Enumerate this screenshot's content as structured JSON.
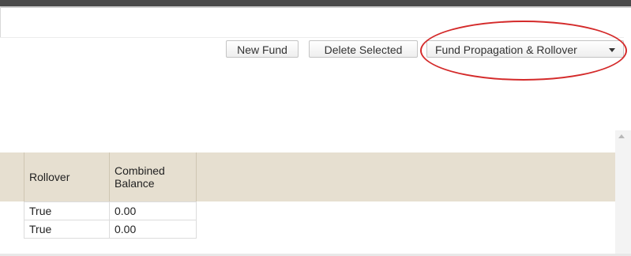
{
  "toolbar": {
    "new_fund_label": "New Fund",
    "delete_selected_label": "Delete Selected",
    "fund_propagation_label": "Fund Propagation & Rollover"
  },
  "icons": {
    "dropdown": "chevron-down-icon",
    "scroll_up": "arrow-up-icon"
  },
  "colors": {
    "highlight_ellipse": "#d42a2a",
    "header_band": "#e6dfd0"
  },
  "table": {
    "columns": [
      "Rollover",
      "Combined Balance"
    ],
    "rows": [
      {
        "rollover": "True",
        "combined_balance": "0.00"
      },
      {
        "rollover": "True",
        "combined_balance": "0.00"
      }
    ]
  }
}
